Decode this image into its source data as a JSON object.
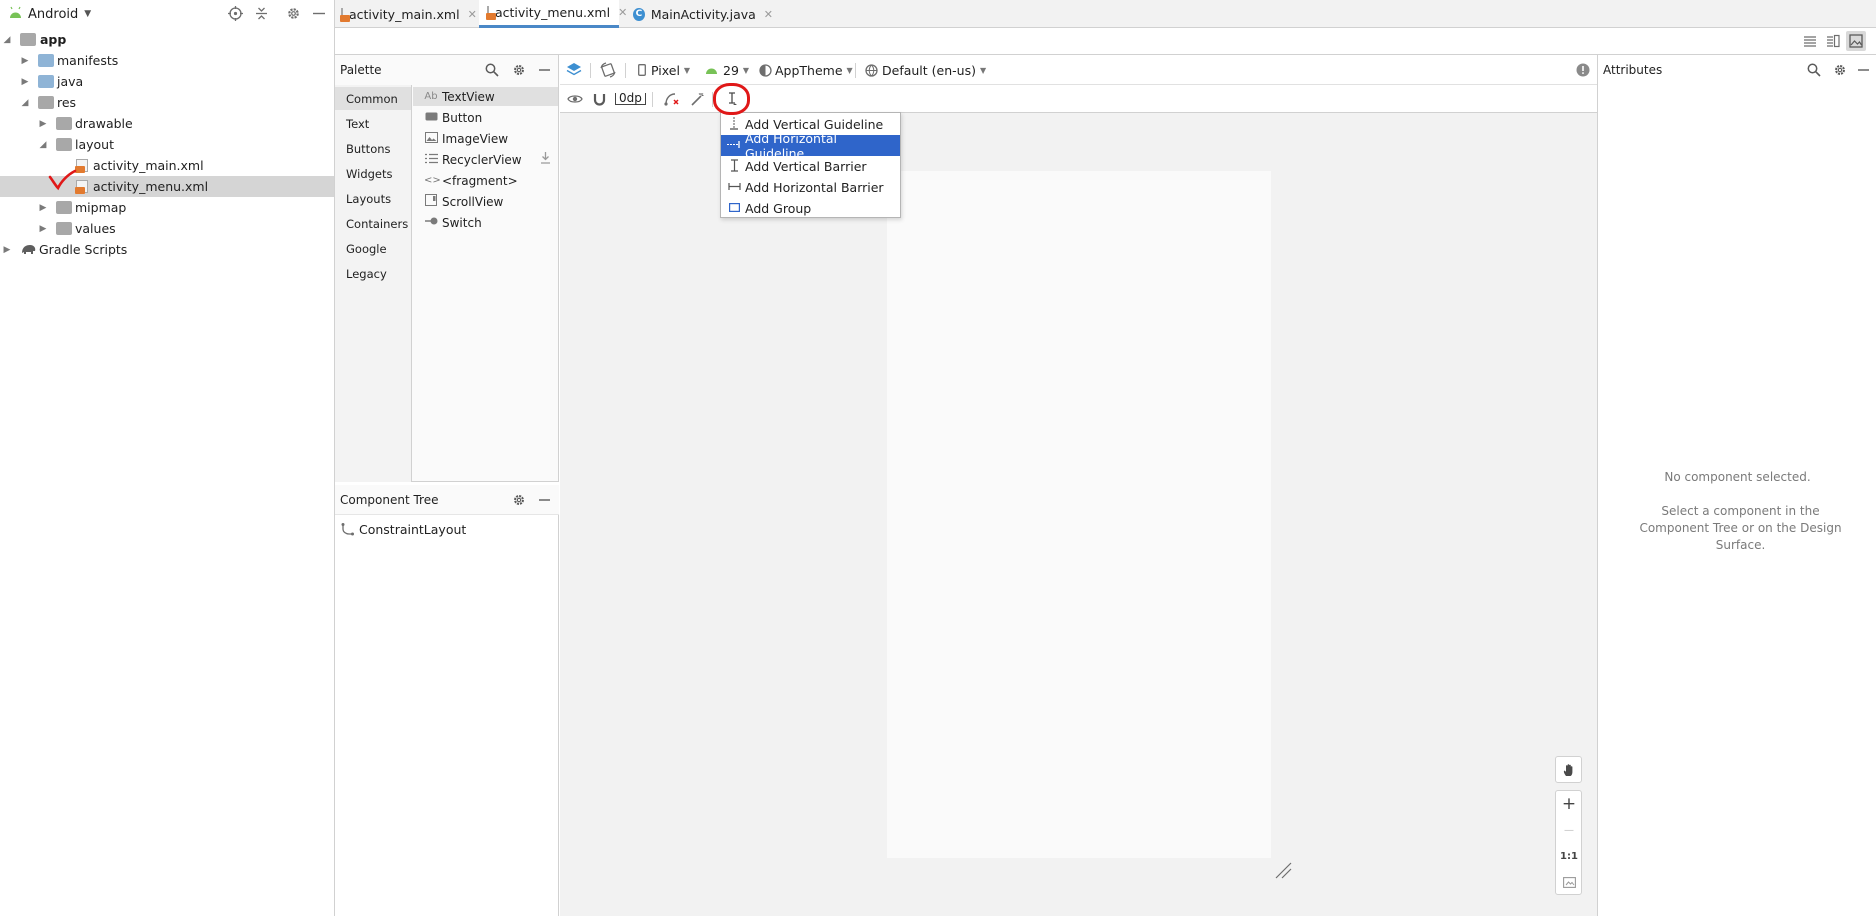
{
  "project_panel": {
    "view_selector": "Android",
    "tree": [
      {
        "label": "app",
        "kind": "module",
        "expanded": true
      },
      {
        "label": "manifests",
        "kind": "folder",
        "expanded": false
      },
      {
        "label": "java",
        "kind": "folder",
        "expanded": false
      },
      {
        "label": "res",
        "kind": "folder",
        "expanded": true
      },
      {
        "label": "drawable",
        "kind": "folder",
        "expanded": false
      },
      {
        "label": "layout",
        "kind": "folder",
        "expanded": true
      },
      {
        "label": "activity_main.xml",
        "kind": "xml"
      },
      {
        "label": "activity_menu.xml",
        "kind": "xml",
        "selected": true
      },
      {
        "label": "mipmap",
        "kind": "folder",
        "expanded": false
      },
      {
        "label": "values",
        "kind": "folder",
        "expanded": false
      },
      {
        "label": "Gradle Scripts",
        "kind": "gradle",
        "expanded": false
      }
    ]
  },
  "tabs": [
    {
      "label": "activity_main.xml",
      "active": false
    },
    {
      "label": "activity_menu.xml",
      "active": true
    },
    {
      "label": "MainActivity.java",
      "active": false
    }
  ],
  "palette": {
    "title": "Palette",
    "categories": [
      "Common",
      "Text",
      "Buttons",
      "Widgets",
      "Layouts",
      "Containers",
      "Google",
      "Legacy"
    ],
    "items": [
      {
        "icon": "Ab",
        "label": "TextView"
      },
      {
        "icon": "button-icon",
        "label": "Button"
      },
      {
        "icon": "image-icon",
        "label": "ImageView"
      },
      {
        "icon": "list-icon",
        "label": "RecyclerView"
      },
      {
        "icon": "<>",
        "label": "<fragment>"
      },
      {
        "icon": "scroll-icon",
        "label": "ScrollView"
      },
      {
        "icon": "switch-icon",
        "label": "Switch"
      }
    ]
  },
  "component_tree": {
    "title": "Component Tree",
    "root": "ConstraintLayout"
  },
  "design_toolbar": {
    "device": "Pixel",
    "api_level": "29",
    "theme": "AppTheme",
    "locale": "Default (en-us)",
    "default_margin": "0dp"
  },
  "guideline_menu": {
    "items": [
      {
        "label": "Add Vertical Guideline",
        "icon": "vertical-guideline-icon",
        "selected": false
      },
      {
        "label": "Add Horizontal Guideline",
        "icon": "horizontal-guideline-icon",
        "selected": true
      },
      {
        "label": "Add Vertical Barrier",
        "icon": "vertical-barrier-icon",
        "selected": false
      },
      {
        "label": "Add Horizontal Barrier",
        "icon": "horizontal-barrier-icon",
        "selected": false
      },
      {
        "label": "Add Group",
        "icon": "group-icon",
        "selected": false
      }
    ]
  },
  "zoom_controls": {
    "zoom_in": "+",
    "zoom_out": "—",
    "actual_size": "1:1"
  },
  "attributes": {
    "title": "Attributes",
    "empty_title": "No component selected.",
    "empty_hint": "Select a component in the Component Tree or on the Design Surface."
  },
  "colors": {
    "selection_blue": "#2f65ca",
    "annotation_red": "#e01818",
    "android_green": "#78c257",
    "tab_underline": "#4a88c7"
  }
}
